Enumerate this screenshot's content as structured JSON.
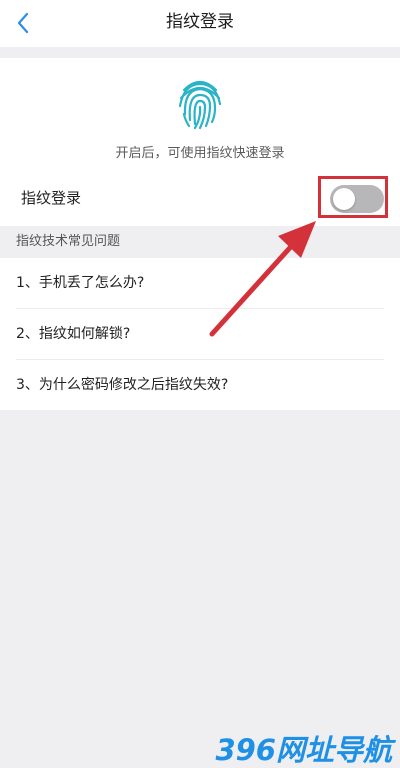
{
  "header": {
    "title": "指纹登录",
    "back_icon": "chevron-left-icon",
    "back_color": "#2c8ee8"
  },
  "fingerprint": {
    "icon": "fingerprint-icon",
    "icon_color": "#2bb3c7",
    "description": "开启后，可使用指纹快速登录"
  },
  "toggle": {
    "label": "指纹登录",
    "state": "off",
    "highlight_color": "#d4323a"
  },
  "faq": {
    "section_title": "指纹技术常见问题",
    "items": [
      "1、手机丢了怎么办?",
      "2、指纹如何解锁?",
      "3、为什么密码修改之后指纹失效?"
    ]
  },
  "annotation": {
    "arrow_color": "#d4323a"
  },
  "watermark": {
    "text": "396网址导航",
    "color": "#1e90e6"
  }
}
